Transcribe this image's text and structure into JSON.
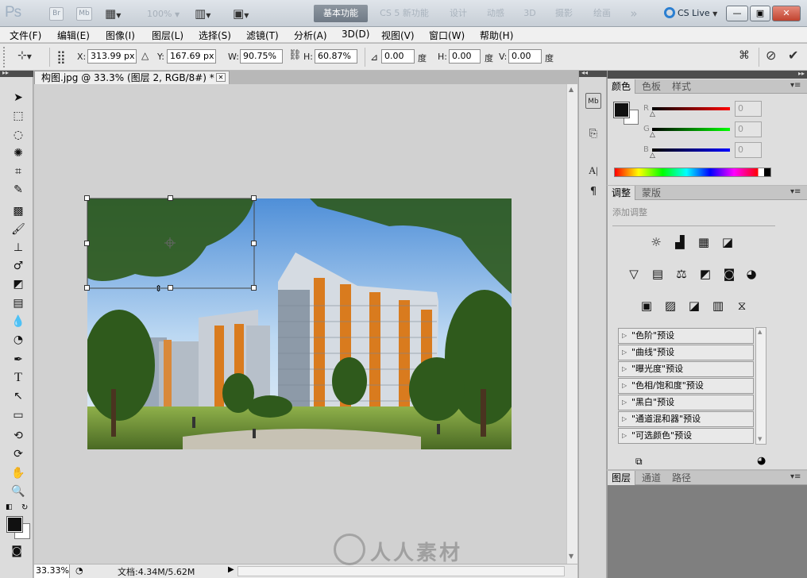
{
  "app": {
    "logo": "Ps",
    "bridge_button": "Br",
    "minibridge_button": "Mb",
    "zoom_display": "100%",
    "workspaces": [
      "基本功能",
      "CS 5 新功能",
      "设计",
      "动感",
      "3D",
      "摄影",
      "绘画"
    ],
    "more_workspaces": "»",
    "cs_live": "CS Live",
    "window_controls": {
      "minimize": "—",
      "restore": "▣",
      "close": "✕"
    }
  },
  "menu": [
    "文件(F)",
    "编辑(E)",
    "图像(I)",
    "图层(L)",
    "选择(S)",
    "滤镜(T)",
    "分析(A)",
    "3D(D)",
    "视图(V)",
    "窗口(W)",
    "帮助(H)"
  ],
  "options": {
    "x_label": "X:",
    "x_value": "313.99 px",
    "y_label": "Y:",
    "y_value": "167.69 px",
    "w_label": "W:",
    "w_value": "90.75%",
    "h_label": "H:",
    "h_value": "60.87%",
    "angle_value": "0.00",
    "angle_unit": "度",
    "hskew_label": "H:",
    "hskew_value": "0.00",
    "hskew_unit": "度",
    "vskew_label": "V:",
    "vskew_value": "0.00",
    "vskew_unit": "度"
  },
  "document": {
    "tab_title": "构图.jpg @ 33.3% (图层 2, RGB/8#) *",
    "status_zoom": "33.33%",
    "status_doc": "文档:4.34M/5.62M"
  },
  "color_panel": {
    "tabs": [
      "颜色",
      "色板",
      "样式"
    ],
    "r_label": "R",
    "g_label": "G",
    "b_label": "B",
    "r_value": "0",
    "g_value": "0",
    "b_value": "0"
  },
  "adjust_panel": {
    "tabs": [
      "调整",
      "蒙版"
    ],
    "heading": "添加调整",
    "presets": [
      "\"色阶\"预设",
      "\"曲线\"预设",
      "\"曝光度\"预设",
      "\"色相/饱和度\"预设",
      "\"黑白\"预设",
      "\"通道混和器\"预设",
      "\"可选颜色\"预设"
    ]
  },
  "layers_panel": {
    "tabs": [
      "图层",
      "通道",
      "路径"
    ]
  },
  "watermark": "人人素材",
  "colors": {
    "accent": "#2b7fd1",
    "panel_bg": "#dedede",
    "canvas_bg": "#d1d1d1",
    "orange_facade": "#d97b1e"
  }
}
